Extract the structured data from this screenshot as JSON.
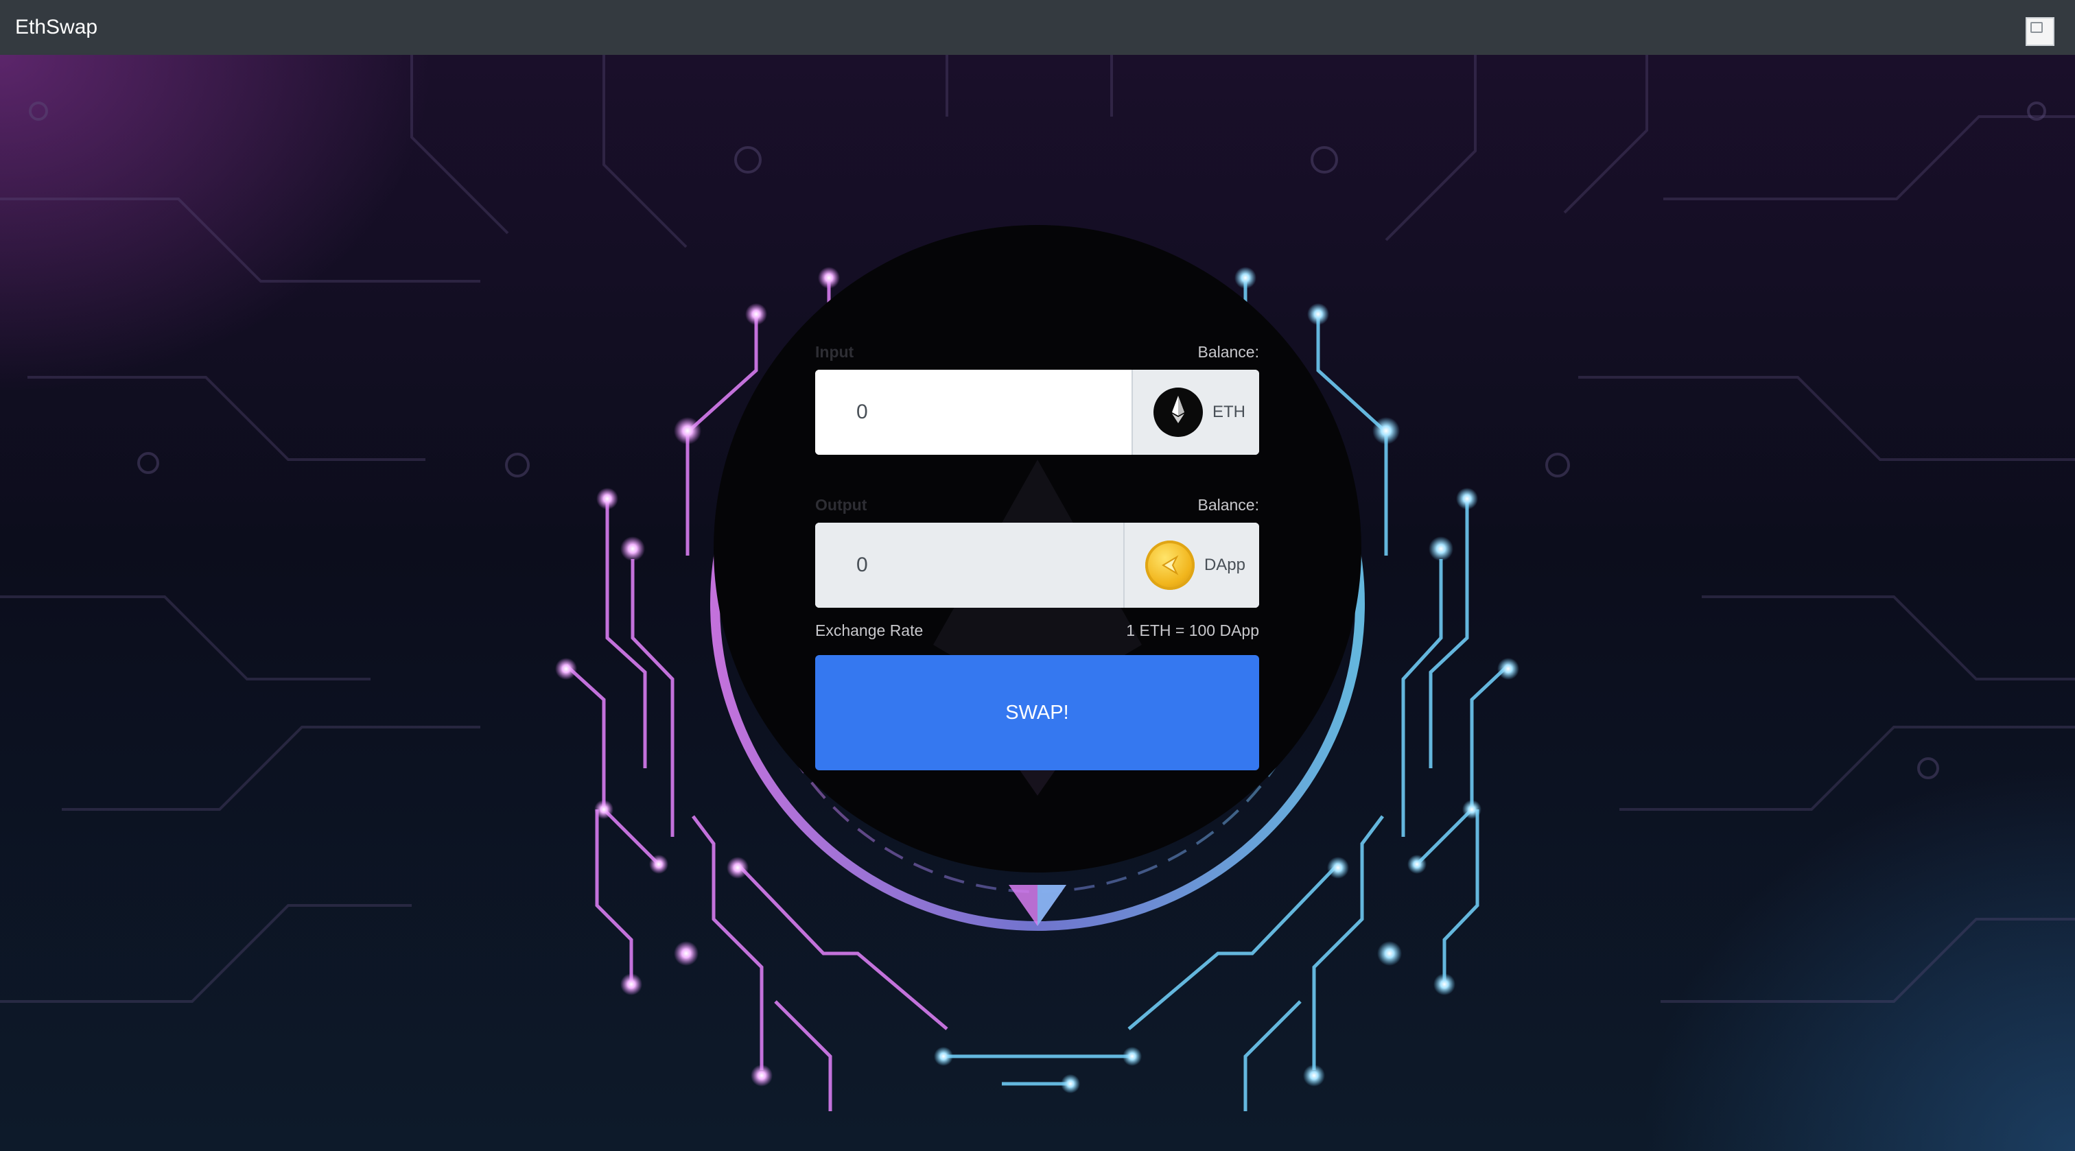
{
  "app": {
    "title": "EthSwap",
    "colors": {
      "navbar": "#343a40",
      "swap_button": "#3578f0",
      "glow_pink": "#d77cf0",
      "glow_blue": "#6ec9f2"
    }
  },
  "navbar": {
    "brand": "EthSwap",
    "account_icon": "broken-image-icon"
  },
  "swap_form": {
    "input": {
      "label": "Input",
      "balance_label": "Balance:",
      "value": "0",
      "token_symbol": "ETH",
      "token_icon": "ethereum-logo-icon"
    },
    "output": {
      "label": "Output",
      "balance_label": "Balance:",
      "value": "0",
      "token_symbol": "DApp",
      "token_icon": "dapp-coin-icon"
    },
    "exchange_rate": {
      "label": "Exchange Rate",
      "value": "1 ETH = 100 DApp"
    },
    "submit_label": "SWAP!"
  }
}
